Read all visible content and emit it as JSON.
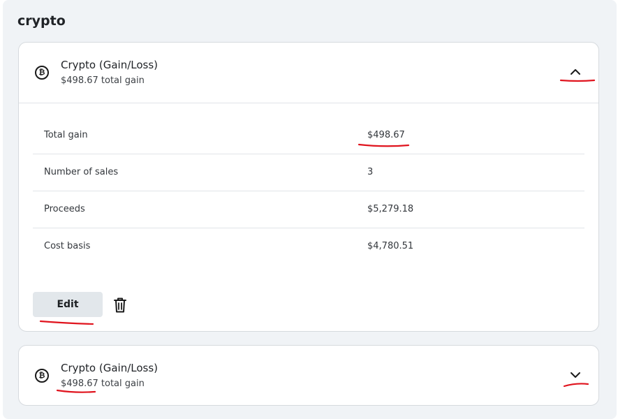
{
  "section": {
    "title": "crypto"
  },
  "cards": [
    {
      "title": "Crypto (Gain/Loss)",
      "subtitle": "$498.67 total gain",
      "icon": "bitcoin-icon",
      "icon_glyph": "₿",
      "state": "expanded",
      "chevron": "chevron-up-icon",
      "rows": [
        {
          "label": "Total gain",
          "value": "$498.67"
        },
        {
          "label": "Number of sales",
          "value": "3"
        },
        {
          "label": "Proceeds",
          "value": "$5,279.18"
        },
        {
          "label": "Cost basis",
          "value": "$4,780.51"
        }
      ],
      "edit_label": "Edit",
      "delete_icon": "trash-icon"
    },
    {
      "title": "Crypto (Gain/Loss)",
      "subtitle": "$498.67 total gain",
      "icon": "bitcoin-icon",
      "icon_glyph": "₿",
      "state": "collapsed",
      "chevron": "chevron-down-icon"
    }
  ],
  "colors": {
    "panel_bg": "#f0f3f6",
    "card_border": "#d6dade",
    "edit_button_bg": "#e2e7eb",
    "annotation": "#e0141e"
  }
}
